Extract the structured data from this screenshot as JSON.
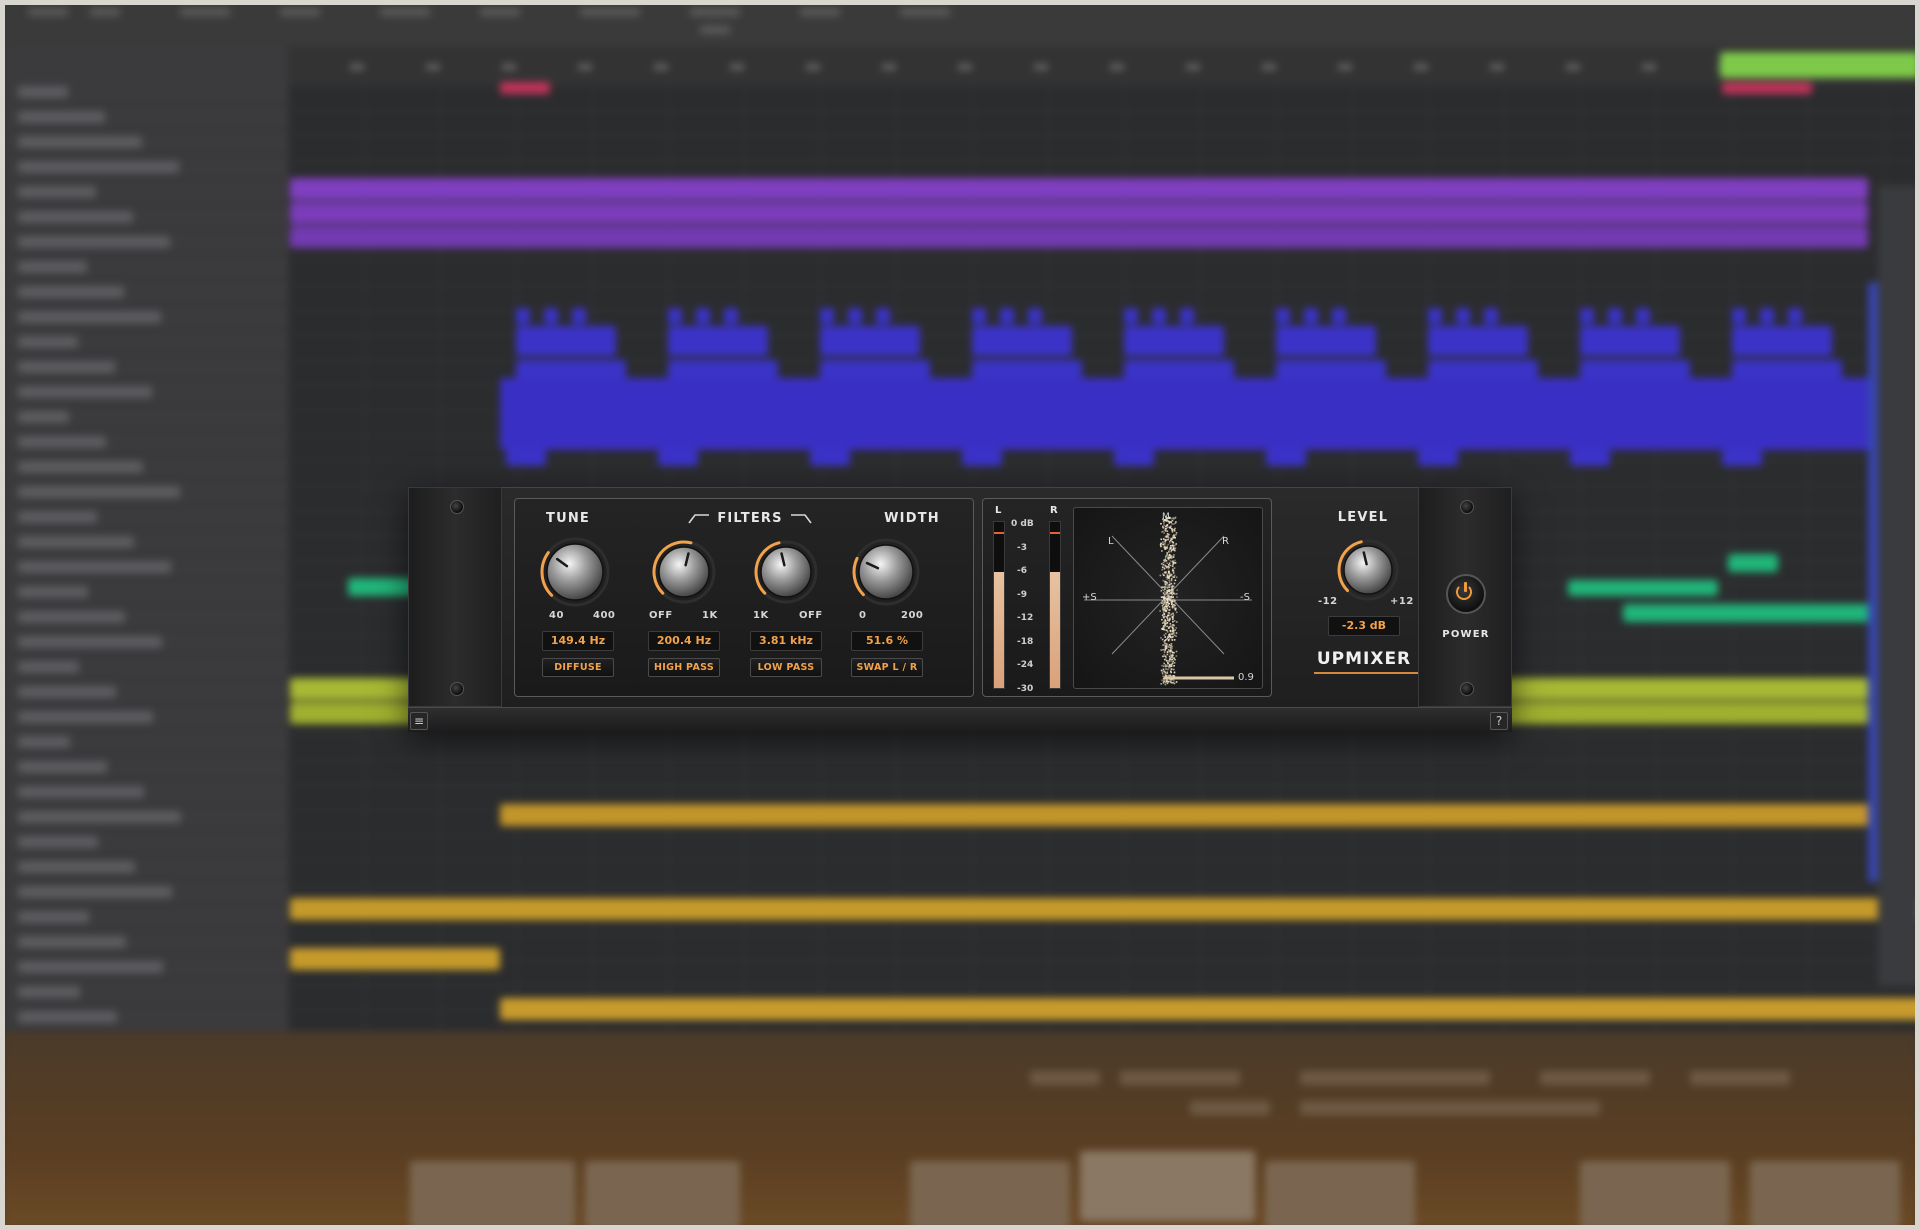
{
  "plugin": {
    "name": "UPMIXER",
    "tune": {
      "label": "TUNE",
      "min_label": "40",
      "max_label": "400",
      "readout": "149.4 Hz",
      "button": "DIFFUSE",
      "level": 0.3
    },
    "filters": {
      "label": "FILTERS",
      "high_pass": {
        "min_label": "OFF",
        "max_label": "1K",
        "readout": "200.4 Hz",
        "button": "HIGH PASS",
        "level": 0.55
      },
      "low_pass": {
        "min_label": "1K",
        "max_label": "OFF",
        "readout": "3.81 kHz",
        "button": "LOW PASS",
        "level": 0.45
      }
    },
    "width": {
      "label": "WIDTH",
      "min_label": "0",
      "max_label": "200",
      "readout": "51.6 %",
      "button": "SWAP L / R",
      "level": 0.26
    },
    "meter": {
      "left_label": "L",
      "right_label": "R",
      "db_labels": [
        "0 dB",
        "-3",
        "-6",
        "-9",
        "-12",
        "-18",
        "-24",
        "-30"
      ],
      "left_level": 0.7,
      "right_level": 0.7
    },
    "scope": {
      "label_l": "L",
      "label_r": "R",
      "label_plus_s": "+S",
      "label_minus_s": "-S",
      "label_m": "M",
      "correlation": "0.9"
    },
    "level": {
      "label": "LEVEL",
      "min_label": "-12",
      "max_label": "+12",
      "readout": "-2.3 dB",
      "level": 0.45
    },
    "power": {
      "label": "POWER"
    },
    "menu_icon": "hamburger-icon",
    "help_label": "?",
    "colors": {
      "accent": "#f2a24a",
      "meter": "#e0b08a",
      "panel": "#1f1f20"
    }
  }
}
